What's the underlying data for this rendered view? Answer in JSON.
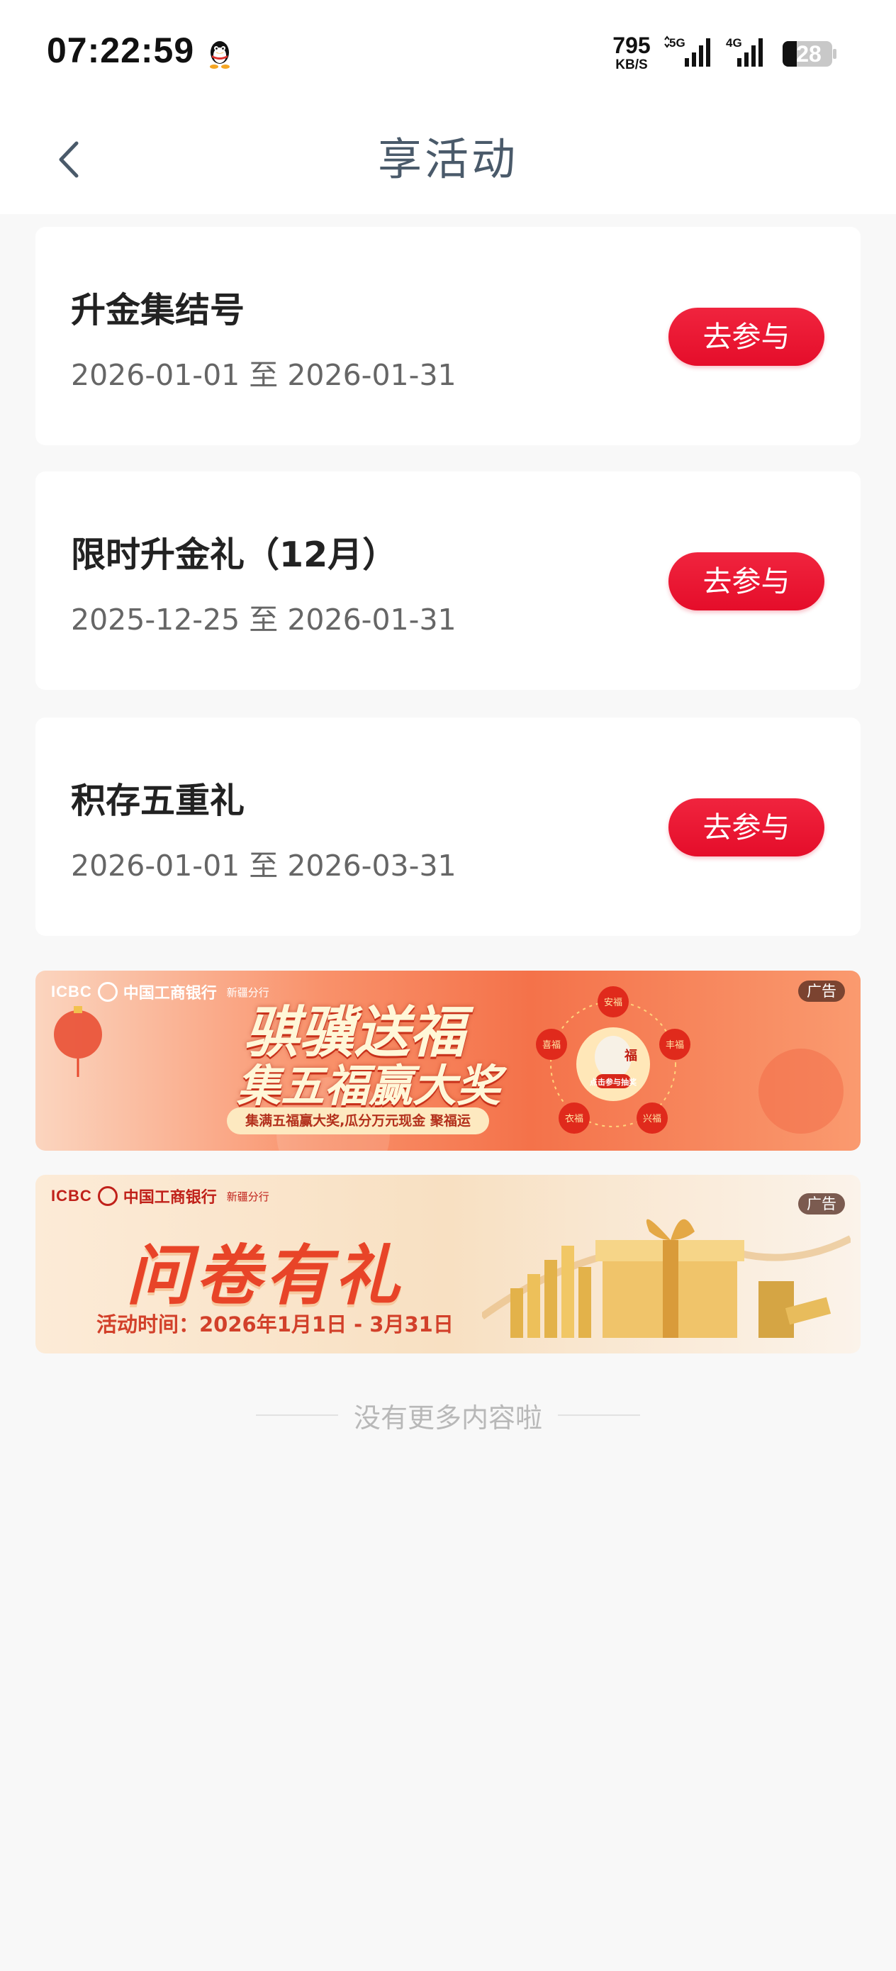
{
  "status_bar": {
    "time": "07:22:59",
    "net_speed": "795",
    "net_speed_unit": "KB/S",
    "signal1_label": "5G",
    "signal2_label": "4G",
    "battery": "28"
  },
  "nav": {
    "title": "享活动"
  },
  "activities": [
    {
      "title": "升金集结号",
      "date": "2026-01-01 至 2026-01-31",
      "button": "去参与"
    },
    {
      "title": "限时升金礼（12月）",
      "date": "2025-12-25 至 2026-01-31",
      "button": "去参与"
    },
    {
      "title": "积存五重礼",
      "date": "2026-01-01 至 2026-03-31",
      "button": "去参与"
    }
  ],
  "banners": [
    {
      "bank_en": "ICBC",
      "bank_cn": "中国工商银行",
      "branch": "新疆分行",
      "ad_tag": "广告",
      "headline_line1": "骐骥送福",
      "headline_line2": "集五福赢大奖",
      "subline": "集满五福赢大奖,瓜分万元现金 聚福运",
      "wheel_center": "点击参与抽奖",
      "wheel_items": [
        "安福",
        "丰福",
        "兴福",
        "衣福",
        "喜福"
      ],
      "center_char": "福"
    },
    {
      "bank_en": "ICBC",
      "bank_cn": "中国工商银行",
      "branch": "新疆分行",
      "ad_tag": "广告",
      "headline": "问卷有礼",
      "time_text": "活动时间：2026年1月1日 - 3月31日"
    }
  ],
  "footer": {
    "no_more": "没有更多内容啦"
  },
  "colors": {
    "accent_red": "#e50d2a",
    "title_grey": "#4a5a6a",
    "page_bg": "#f8f8f8"
  },
  "icons": {
    "back": "chevron-left-icon",
    "qq": "qq-penguin-icon",
    "signal": "cell-signal-icon",
    "battery": "battery-icon"
  }
}
